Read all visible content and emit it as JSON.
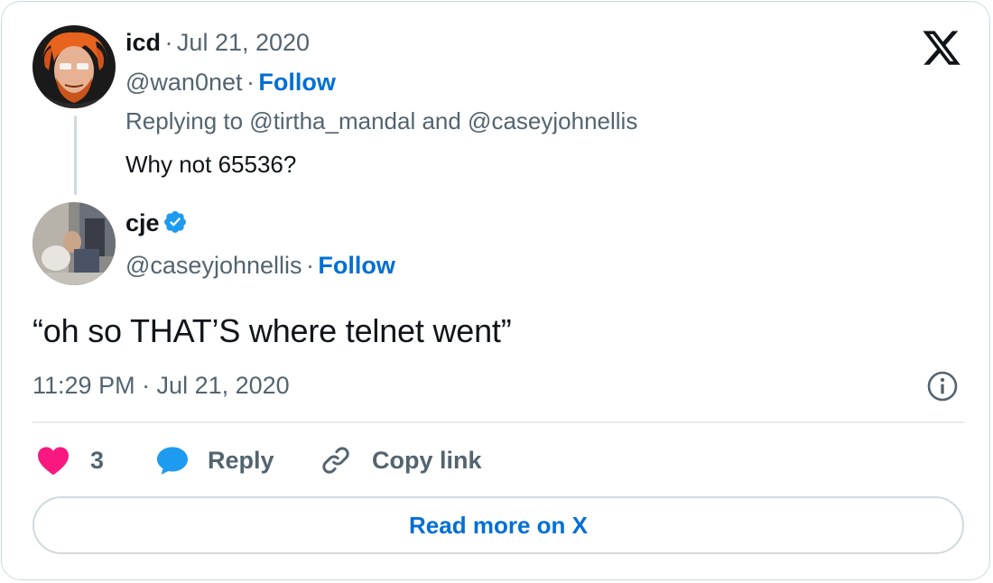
{
  "reply_tweet": {
    "name": "icd",
    "date": "Jul 21, 2020",
    "handle": "@wan0net",
    "follow_label": "Follow",
    "replying_to": "Replying to @tirtha_mandal and @caseyjohnellis",
    "text": "Why not 65536?"
  },
  "main_tweet": {
    "name": "cje",
    "verified": true,
    "handle": "@caseyjohnellis",
    "follow_label": "Follow",
    "text": "“oh so THAT’S where telnet went”",
    "timestamp": "11:29 PM · Jul 21, 2020"
  },
  "separator": "·",
  "actions": {
    "like_count": "3",
    "reply_label": "Reply",
    "copy_link_label": "Copy link"
  },
  "read_more_label": "Read more on X",
  "colors": {
    "link_blue": "#006fd6",
    "like_pink": "#f91880",
    "reply_blue": "#1d9bf0",
    "muted_gray": "#536471",
    "border": "#cfd9de"
  },
  "icons": {
    "brand": "x-logo-icon",
    "verified": "verified-badge-icon",
    "info": "info-icon",
    "like": "heart-icon",
    "reply": "speech-bubble-icon",
    "copy": "link-icon"
  }
}
